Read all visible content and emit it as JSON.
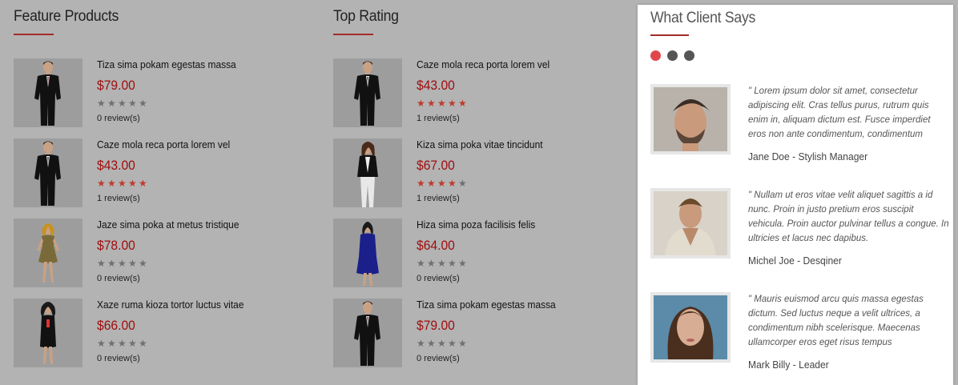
{
  "feature": {
    "title": "Feature Products",
    "products": [
      {
        "name": "Tiza sima pokam egestas massa",
        "price": "$79.00",
        "rating": 0,
        "reviews": "0 review(s)",
        "figure": "suit-man"
      },
      {
        "name": "Caze mola reca porta lorem vel",
        "price": "$43.00",
        "rating": 5,
        "reviews": "1 review(s)",
        "figure": "tux-man"
      },
      {
        "name": "Jaze sima poka at metus tristique",
        "price": "$78.00",
        "rating": 0,
        "reviews": "0 review(s)",
        "figure": "gold-dress"
      },
      {
        "name": "Xaze ruma kioza tortor luctus vitae",
        "price": "$66.00",
        "rating": 0,
        "reviews": "0 review(s)",
        "figure": "black-dress"
      }
    ]
  },
  "top": {
    "title": "Top Rating",
    "products": [
      {
        "name": "Caze mola reca porta lorem vel",
        "price": "$43.00",
        "rating": 5,
        "reviews": "1 review(s)",
        "figure": "tux-man"
      },
      {
        "name": "Kiza sima poka vitae tincidunt",
        "price": "$67.00",
        "rating": 4,
        "reviews": "1 review(s)",
        "figure": "jacket-woman"
      },
      {
        "name": "Hiza sima poza facilisis felis",
        "price": "$64.00",
        "rating": 0,
        "reviews": "0 review(s)",
        "figure": "blue-dress"
      },
      {
        "name": "Tiza sima pokam egestas massa",
        "price": "$79.00",
        "rating": 0,
        "reviews": "0 review(s)",
        "figure": "suit-man"
      }
    ]
  },
  "clients": {
    "title": "What Client Says",
    "active_dot": 0,
    "dot_count": 3,
    "items": [
      {
        "quote": "\" Lorem ipsum dolor sit amet, consectetur adipiscing elit. Cras tellus purus, rutrum quis enim in, aliquam dictum est. Fusce imperdiet eros non ante condimentum, condimentum",
        "name": "Jane Doe - Stylish Manager",
        "avatar": "man-beard"
      },
      {
        "quote": "\" Nullam ut eros vitae velit aliquet sagittis a id nunc. Proin in justo pretium eros suscipit vehicula. Proin auctor pulvinar tellus a congue. In ultricies et lacus nec dapibus.",
        "name": "Michel Joe - Desqiner",
        "avatar": "man-casual"
      },
      {
        "quote": "\" Mauris euismod arcu quis massa egestas dictum. Sed luctus neque a velit ultrices, a condimentum nibh scelerisque. Maecenas ullamcorper eros eget risus tempus",
        "name": "Mark Billy - Leader",
        "avatar": "woman-portrait"
      }
    ]
  },
  "colors": {
    "accent": "#a00d0d",
    "star_on": "#c0392b",
    "star_off": "#6f6f6f",
    "dot_active": "#e0474c",
    "dot_inactive": "#555555"
  }
}
